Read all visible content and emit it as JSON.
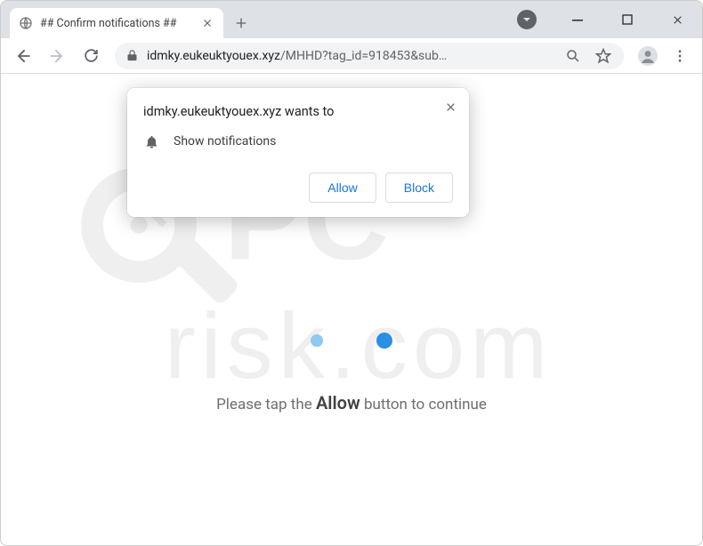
{
  "tab": {
    "title": "## Confirm notifications ##"
  },
  "omnibox": {
    "host": "idmky.eukeuktyouex.xyz",
    "path": "/MHHD?tag_id=918453&sub…"
  },
  "permission": {
    "origin": "idmky.eukeuktyouex.xyz wants to",
    "capability": "Show notifications",
    "allow_label": "Allow",
    "block_label": "Block"
  },
  "page": {
    "instruction_pre": "Please tap the ",
    "instruction_em": "Allow",
    "instruction_post": " button to continue"
  }
}
